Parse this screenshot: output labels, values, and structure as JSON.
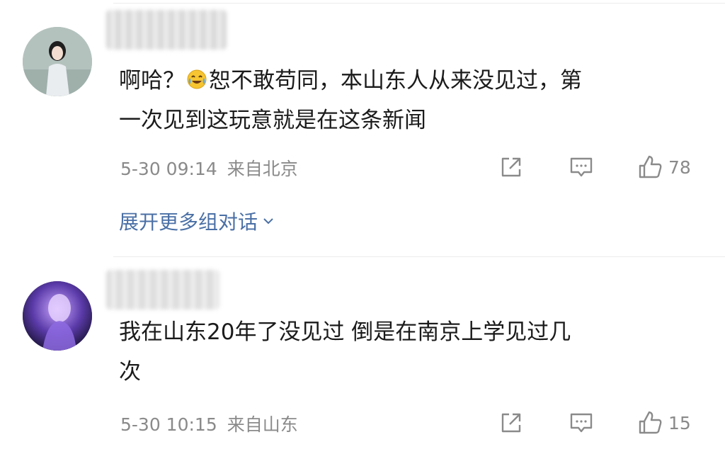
{
  "comments": [
    {
      "username": "",
      "text_before_emoji": "啊哈？",
      "emoji_icon": "crying-laughing-emoji",
      "text_line1_after_emoji": "恕不敢苟同，本山东人从来没见过，第",
      "text_line2": "一次见到这玩意就是在这条新闻",
      "date": "5-30 09:14",
      "location": "来自北京",
      "likes": "78",
      "expand_label": "展开更多组对话"
    },
    {
      "username": "",
      "text_line1": "我在山东20年了没见过 倒是在南京上学见过几",
      "text_line2": "次",
      "date": "5-30 10:15",
      "location": "来自山东",
      "likes": "15"
    }
  ],
  "colors": {
    "text": "#1b1b1b",
    "meta": "#8a8a8a",
    "link": "#4a6fa5",
    "divider": "#ececec"
  }
}
